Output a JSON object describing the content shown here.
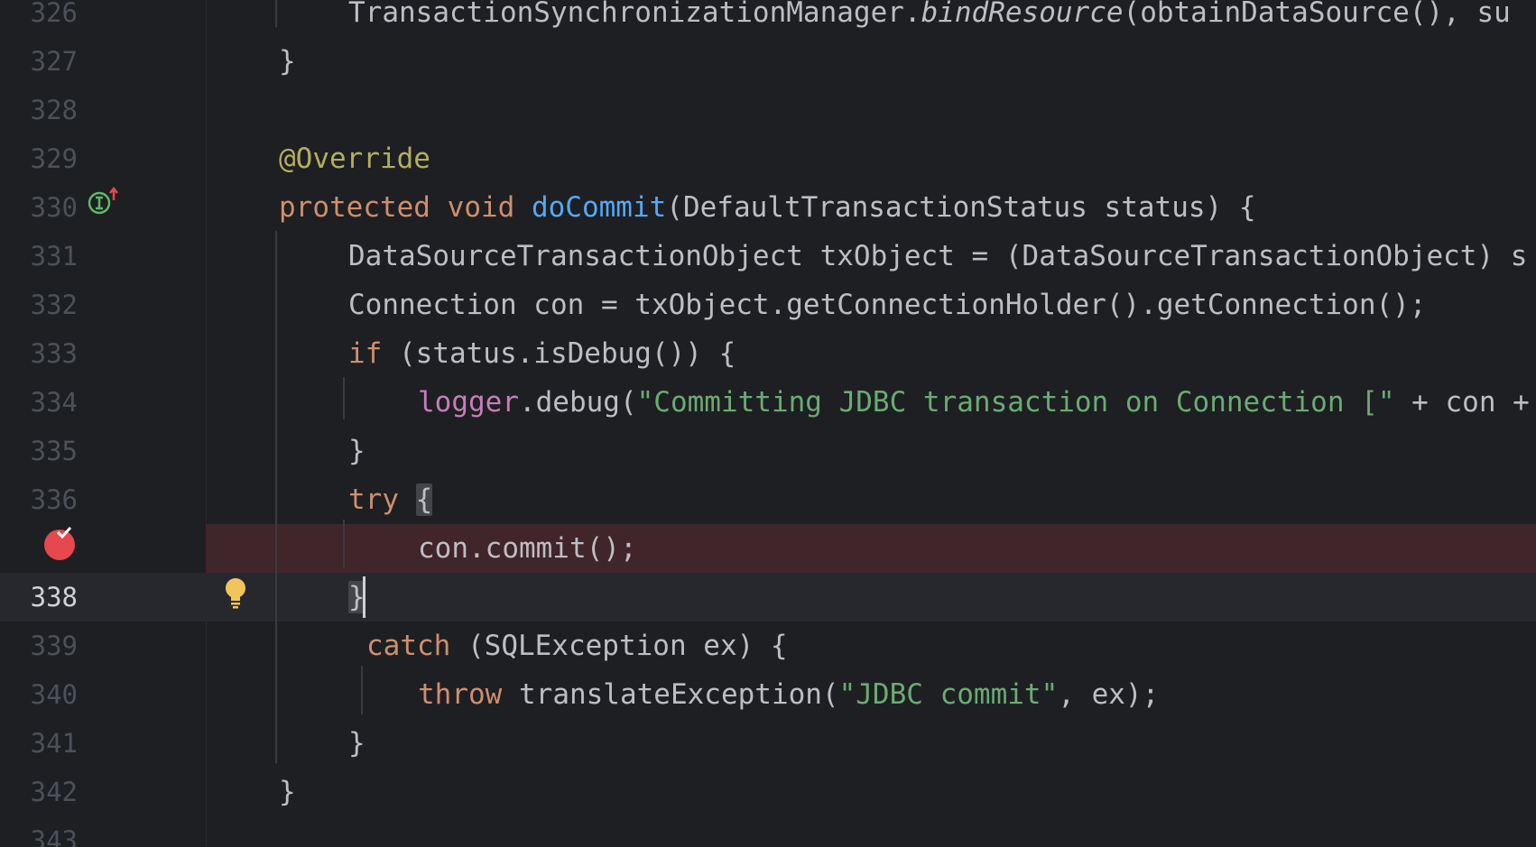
{
  "editor": {
    "language": "Java",
    "theme_colors": {
      "background": "#1e1f22",
      "keyword": "#cf8e6d",
      "annotation": "#b3ae60",
      "function": "#56a8f5",
      "string": "#6aab73",
      "field": "#c77dbb",
      "text": "#bcbec4",
      "breakpoint_line": "#40252b",
      "breakpoint_icon": "#e5484d",
      "implements_icon": "#5fb865",
      "bulb_icon": "#f2c55c"
    },
    "lines": [
      {
        "number": "326",
        "tokens": [
          {
            "text": "TransactionSynchronizationManager.",
            "cls": "tok-plain"
          },
          {
            "text": "bindResource",
            "cls": "tok-italic"
          },
          {
            "text": "(obtainDataSource(), su",
            "cls": "tok-plain"
          }
        ]
      },
      {
        "number": "327",
        "tokens": [
          {
            "text": "}",
            "cls": "tok-plain"
          }
        ]
      },
      {
        "number": "328",
        "tokens": []
      },
      {
        "number": "329",
        "tokens": [
          {
            "text": "@Override",
            "cls": "tok-ann"
          }
        ]
      },
      {
        "number": "330",
        "tokens": [
          {
            "text": "protected",
            "cls": "tok-kw"
          },
          {
            "text": " ",
            "cls": "tok-plain"
          },
          {
            "text": "void",
            "cls": "tok-kw"
          },
          {
            "text": " ",
            "cls": "tok-plain"
          },
          {
            "text": "doCommit",
            "cls": "tok-fn"
          },
          {
            "text": "(DefaultTransactionStatus status) {",
            "cls": "tok-plain"
          }
        ]
      },
      {
        "number": "331",
        "tokens": [
          {
            "text": "DataSourceTransactionObject txObject = (DataSourceTransactionObject) s",
            "cls": "tok-plain"
          }
        ]
      },
      {
        "number": "332",
        "tokens": [
          {
            "text": "Connection con = txObject.getConnectionHolder().getConnection();",
            "cls": "tok-plain"
          }
        ]
      },
      {
        "number": "333",
        "tokens": [
          {
            "text": "if",
            "cls": "tok-kw"
          },
          {
            "text": " (status.isDebug()) {",
            "cls": "tok-plain"
          }
        ]
      },
      {
        "number": "334",
        "tokens": [
          {
            "text": "logger",
            "cls": "tok-field"
          },
          {
            "text": ".debug(",
            "cls": "tok-plain"
          },
          {
            "text": "\"Committing JDBC transaction on Connection [\"",
            "cls": "tok-str"
          },
          {
            "text": " + con +",
            "cls": "tok-plain"
          }
        ]
      },
      {
        "number": "335",
        "tokens": [
          {
            "text": "}",
            "cls": "tok-plain"
          }
        ]
      },
      {
        "number": "336",
        "tokens": [
          {
            "text": "try",
            "cls": "tok-kw"
          },
          {
            "text": " ",
            "cls": "tok-plain"
          },
          {
            "text": "{",
            "cls": "brace-hl"
          }
        ]
      },
      {
        "number": "",
        "tokens": [
          {
            "text": "con.commit();",
            "cls": "tok-plain"
          }
        ]
      },
      {
        "number": "338",
        "tokens": [
          {
            "text": "}",
            "cls": "brace-hl"
          }
        ]
      },
      {
        "number": "339",
        "tokens": [
          {
            "text": "catch",
            "cls": "tok-kw"
          },
          {
            "text": " (SQLException ex) {",
            "cls": "tok-plain"
          }
        ]
      },
      {
        "number": "340",
        "tokens": [
          {
            "text": "throw",
            "cls": "tok-kw"
          },
          {
            "text": " translateException(",
            "cls": "tok-plain"
          },
          {
            "text": "\"JDBC commit\"",
            "cls": "tok-str"
          },
          {
            "text": ", ex);",
            "cls": "tok-plain"
          }
        ]
      },
      {
        "number": "341",
        "tokens": [
          {
            "text": "}",
            "cls": "tok-plain"
          }
        ]
      },
      {
        "number": "342",
        "tokens": [
          {
            "text": "}",
            "cls": "tok-plain"
          }
        ]
      },
      {
        "number": "343",
        "tokens": []
      }
    ],
    "gutter_icons": {
      "implements": "implements-method-icon",
      "breakpoint": "breakpoint-verified-icon",
      "intention": "intention-bulb-icon"
    }
  }
}
